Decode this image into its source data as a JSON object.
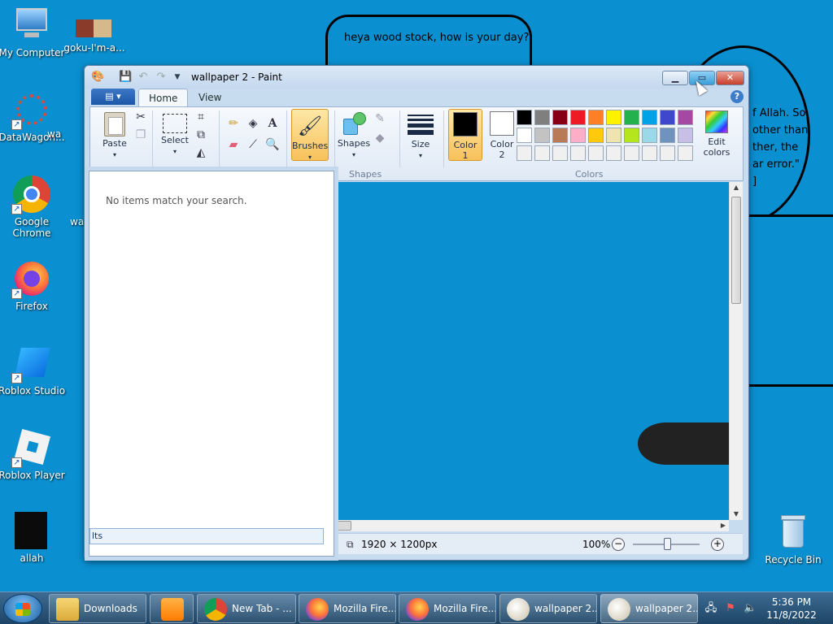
{
  "wallpaper": {
    "bubble1_text": "heya wood stock, how is your day?",
    "bubble2_text": "f Allah. So,\n other than\nther, the\nar error.\"\n]"
  },
  "desktop": {
    "icons": [
      {
        "label": "My Computer"
      },
      {
        "label": "goku-I'm-a..."
      },
      {
        "label": "DataWagon..."
      },
      {
        "label": "wa"
      },
      {
        "label": "Google Chrome"
      },
      {
        "label": "wa"
      },
      {
        "label": "Firefox"
      },
      {
        "label": "Roblox Studio"
      },
      {
        "label": "Roblox Player"
      },
      {
        "label": "allah"
      },
      {
        "label": "Recycle Bin"
      }
    ]
  },
  "paint": {
    "title": "wallpaper 2 - Paint",
    "tabs": {
      "home": "Home",
      "view": "View"
    },
    "ribbon": {
      "paste": "Paste",
      "select": "Select",
      "brushes": "Brushes",
      "shapes": "Shapes",
      "shapes_group": "Shapes",
      "size": "Size",
      "color1": "Color\n1",
      "color2": "Color\n2",
      "edit_colors": "Edit\ncolors",
      "colors_group": "Colors"
    },
    "palette": {
      "row1": [
        "#000000",
        "#7f7f7f",
        "#880015",
        "#ed1c24",
        "#ff7f27",
        "#fff200",
        "#22b14c",
        "#00a2e8",
        "#3f48cc",
        "#a349a4"
      ],
      "row2": [
        "#ffffff",
        "#c3c3c3",
        "#b97a57",
        "#ffaec9",
        "#ffc90e",
        "#efe4b0",
        "#b5e61d",
        "#99d9ea",
        "#7092be",
        "#c8bfe7"
      ],
      "row3": [
        "#f0f0f0",
        "#f0f0f0",
        "#f0f0f0",
        "#f0f0f0",
        "#f0f0f0",
        "#f0f0f0",
        "#f0f0f0",
        "#f0f0f0",
        "#f0f0f0",
        "#f0f0f0"
      ],
      "color1_value": "#000000",
      "color2_value": "#ffffff"
    },
    "status": {
      "dimensions": "1920 × 1200px",
      "zoom": "100%"
    }
  },
  "search_panel": {
    "message": "No items match your search.",
    "footer_text": "lts"
  },
  "taskbar": {
    "items": [
      {
        "label": "Downloads"
      },
      {
        "label": ""
      },
      {
        "label": "New Tab - ..."
      },
      {
        "label": "Mozilla Fire..."
      },
      {
        "label": "Mozilla Fire..."
      },
      {
        "label": "wallpaper 2..."
      },
      {
        "label": "wallpaper 2..."
      }
    ],
    "clock_time": "5:36 PM",
    "clock_date": "11/8/2022"
  }
}
